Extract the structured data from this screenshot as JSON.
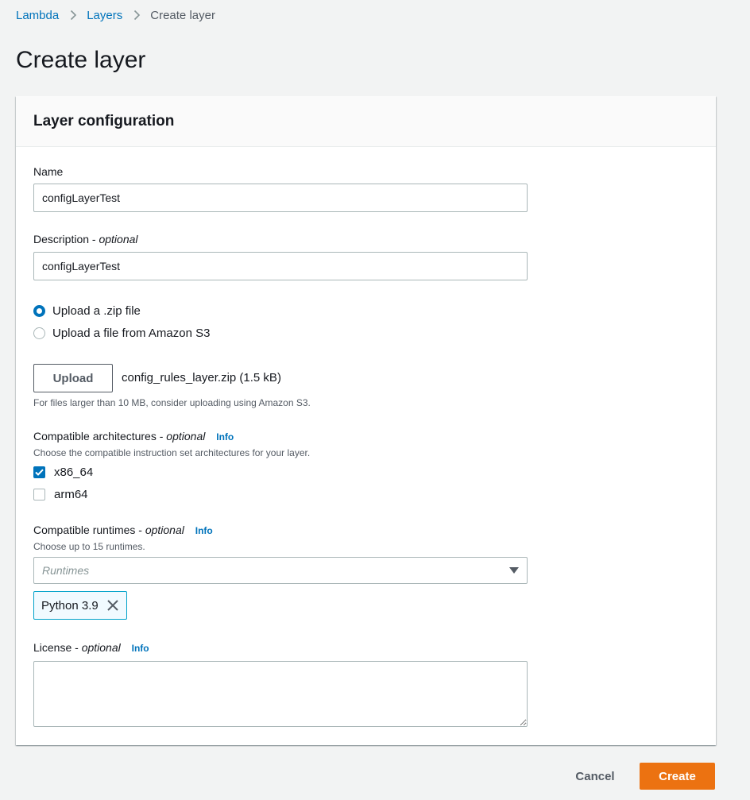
{
  "breadcrumb": {
    "items": [
      "Lambda",
      "Layers"
    ],
    "current": "Create layer"
  },
  "page": {
    "title": "Create layer"
  },
  "panel": {
    "title": "Layer configuration",
    "name": {
      "label": "Name",
      "value": "configLayerTest"
    },
    "description": {
      "label": "Description - ",
      "optional": "optional",
      "value": "configLayerTest"
    },
    "upload_options": [
      {
        "label": "Upload a .zip file",
        "selected": true
      },
      {
        "label": "Upload a file from Amazon S3",
        "selected": false
      }
    ],
    "upload": {
      "button_label": "Upload",
      "file_name": "config_rules_layer.zip (1.5 kB)",
      "hint": "For files larger than 10 MB, consider uploading using Amazon S3."
    },
    "architectures": {
      "label": "Compatible architectures - ",
      "optional": "optional",
      "info": "Info",
      "description": "Choose the compatible instruction set architectures for your layer.",
      "options": [
        {
          "label": "x86_64",
          "checked": true
        },
        {
          "label": "arm64",
          "checked": false
        }
      ]
    },
    "runtimes": {
      "label": "Compatible runtimes - ",
      "optional": "optional",
      "info": "Info",
      "description": "Choose up to 15 runtimes.",
      "placeholder": "Runtimes",
      "selected": [
        "Python 3.9"
      ]
    },
    "license": {
      "label": "License - ",
      "optional": "optional",
      "info": "Info",
      "value": ""
    }
  },
  "footer": {
    "cancel_label": "Cancel",
    "create_label": "Create"
  },
  "colors": {
    "primary": "#ec7211",
    "link": "#0073bb",
    "token_border": "#00a1c9"
  },
  "icons": [
    "chevron-right-icon",
    "caret-down-icon",
    "close-icon",
    "check-icon"
  ]
}
